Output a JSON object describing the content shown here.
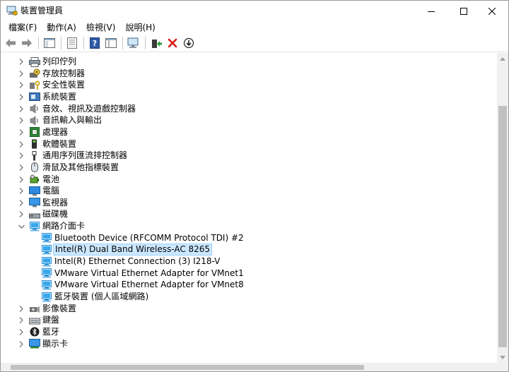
{
  "window": {
    "title": "裝置管理員",
    "icon": "device-manager-icon"
  },
  "menu": [
    "檔案(F)",
    "動作(A)",
    "檢視(V)",
    "說明(H)"
  ],
  "toolbar": {
    "buttons": [
      "back-arrow-icon",
      "forward-arrow-icon",
      "show-hide-tree-icon",
      "properties-icon",
      "help-icon",
      "view-icon",
      "scan-hardware-icon",
      "update-driver-icon",
      "uninstall-icon",
      "disable-device-icon"
    ]
  },
  "tree": {
    "items": [
      {
        "label": "列印佇列",
        "icon": "printer-icon",
        "expanded": false,
        "level": 1
      },
      {
        "label": "存放控制器",
        "icon": "storage-controller-icon",
        "expanded": false,
        "level": 1
      },
      {
        "label": "安全性裝置",
        "icon": "security-key-icon",
        "expanded": false,
        "level": 1
      },
      {
        "label": "系統裝置",
        "icon": "system-folder-icon",
        "expanded": false,
        "level": 1
      },
      {
        "label": "音效、視訊及遊戲控制器",
        "icon": "speaker-icon",
        "expanded": false,
        "level": 1
      },
      {
        "label": "音訊輸入與輸出",
        "icon": "speaker-icon",
        "expanded": false,
        "level": 1
      },
      {
        "label": "處理器",
        "icon": "processor-icon",
        "expanded": false,
        "level": 1
      },
      {
        "label": "軟體裝置",
        "icon": "software-device-icon",
        "expanded": false,
        "level": 1
      },
      {
        "label": "通用序列匯流排控制器",
        "icon": "usb-icon",
        "expanded": false,
        "level": 1
      },
      {
        "label": "滑鼠及其他指標裝置",
        "icon": "mouse-icon",
        "expanded": false,
        "level": 1
      },
      {
        "label": "電池",
        "icon": "battery-icon",
        "expanded": false,
        "level": 1
      },
      {
        "label": "電腦",
        "icon": "computer-icon",
        "expanded": false,
        "level": 1
      },
      {
        "label": "監視器",
        "icon": "monitor-icon",
        "expanded": false,
        "level": 1
      },
      {
        "label": "磁碟機",
        "icon": "disk-drive-icon",
        "expanded": false,
        "level": 1
      },
      {
        "label": "網路介面卡",
        "icon": "network-adapter-icon",
        "expanded": true,
        "level": 1
      },
      {
        "label": "Bluetooth Device (RFCOMM Protocol TDI) #2",
        "icon": "network-adapter-icon",
        "level": 2
      },
      {
        "label": "Intel(R) Dual Band Wireless-AC 8265",
        "icon": "network-adapter-icon",
        "level": 2,
        "selected": true
      },
      {
        "label": "Intel(R) Ethernet Connection (3) I218-V",
        "icon": "network-adapter-icon",
        "level": 2
      },
      {
        "label": "VMware Virtual Ethernet Adapter for VMnet1",
        "icon": "network-adapter-icon",
        "level": 2
      },
      {
        "label": "VMware Virtual Ethernet Adapter for VMnet8",
        "icon": "network-adapter-icon",
        "level": 2
      },
      {
        "label": "藍牙裝置 (個人區域網路)",
        "icon": "network-adapter-icon",
        "level": 2
      },
      {
        "label": "影像裝置",
        "icon": "camera-icon",
        "expanded": false,
        "level": 1
      },
      {
        "label": "鍵盤",
        "icon": "keyboard-icon",
        "expanded": false,
        "level": 1
      },
      {
        "label": "藍牙",
        "icon": "bluetooth-icon",
        "expanded": false,
        "level": 1
      },
      {
        "label": "顯示卡",
        "icon": "display-adapter-icon",
        "expanded": false,
        "level": 1
      }
    ]
  },
  "colors": {
    "selection_bg": "#cce8ff",
    "selection_border": "#99d1ff",
    "close_red": "#e81123",
    "network_icon": "#2a8fd6"
  }
}
